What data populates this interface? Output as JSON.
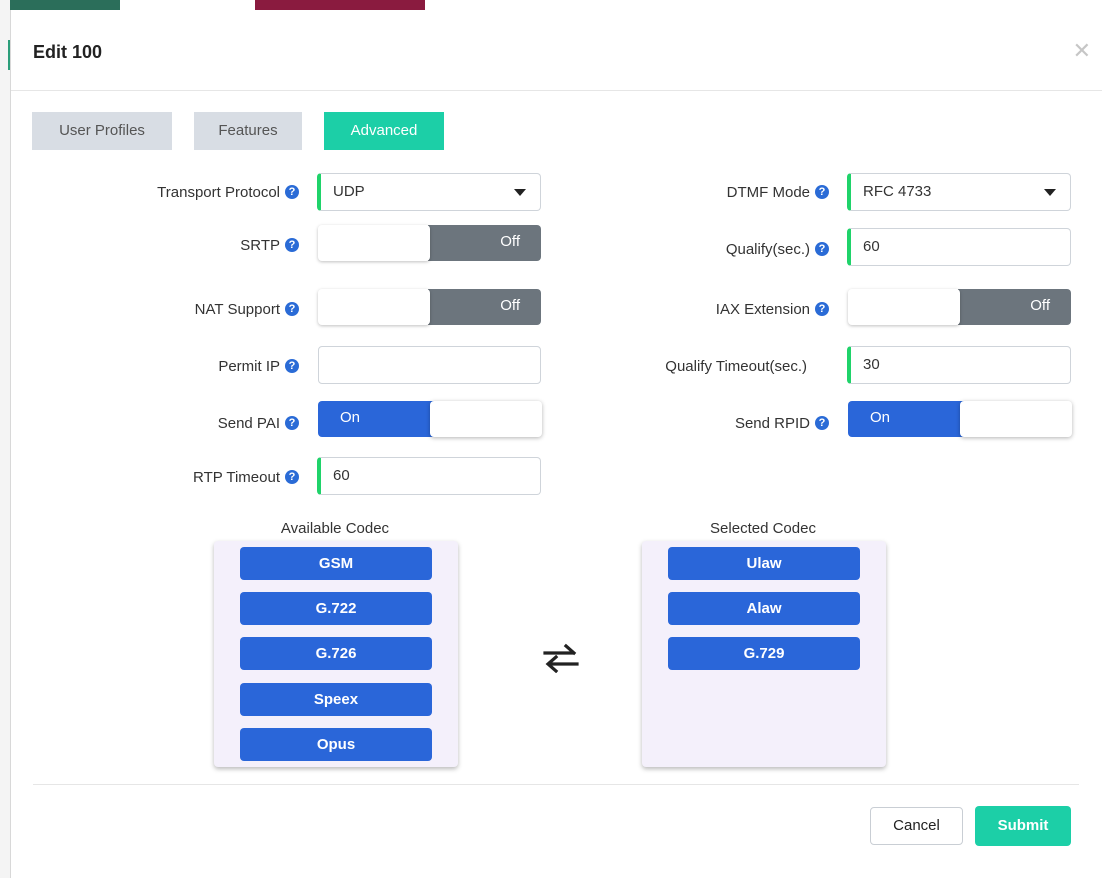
{
  "modal": {
    "title": "Edit 100",
    "close_icon": "close-icon"
  },
  "tabs": [
    {
      "label": "User Profiles",
      "active": false
    },
    {
      "label": "Features",
      "active": false
    },
    {
      "label": "Advanced",
      "active": true
    }
  ],
  "fields": {
    "transport_protocol": {
      "label": "Transport Protocol",
      "value": "UDP"
    },
    "dtmf_mode": {
      "label": "DTMF Mode",
      "value": "RFC 4733"
    },
    "srtp": {
      "label": "SRTP",
      "state": "Off"
    },
    "qualify": {
      "label": "Qualify(sec.)",
      "value": "60"
    },
    "nat_support": {
      "label": "NAT Support",
      "state": "Off"
    },
    "iax_extension": {
      "label": "IAX Extension",
      "state": "Off"
    },
    "permit_ip": {
      "label": "Permit IP",
      "value": ""
    },
    "qualify_timeout": {
      "label": "Qualify Timeout(sec.)",
      "value": "30"
    },
    "send_pai": {
      "label": "Send PAI",
      "state": "On"
    },
    "send_rpid": {
      "label": "Send RPID",
      "state": "On"
    },
    "rtp_timeout": {
      "label": "RTP Timeout",
      "value": "60"
    }
  },
  "help_glyph": "?",
  "codecs": {
    "available_title": "Available Codec",
    "selected_title": "Selected Codec",
    "available": [
      "GSM",
      "G.722",
      "G.726",
      "Speex",
      "Opus"
    ],
    "selected": [
      "Ulaw",
      "Alaw",
      "G.729"
    ],
    "swap_icon": "swap-arrows-icon"
  },
  "footer": {
    "cancel_label": "Cancel",
    "submit_label": "Submit"
  },
  "colors": {
    "accent": "#1ccfa7",
    "primary": "#2a66d9",
    "off_track": "#6c757d",
    "required_marker": "#1fd36a"
  }
}
